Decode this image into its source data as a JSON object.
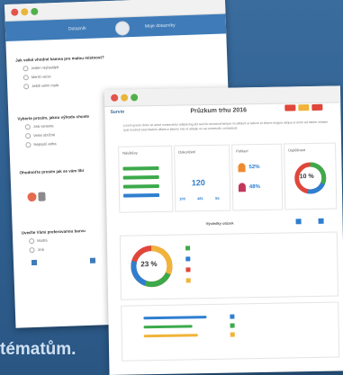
{
  "background_text": "tématům.",
  "back_window": {
    "nav": {
      "tab1": "Dotazník",
      "tab2": "Moje dotazníky"
    },
    "questions": [
      {
        "title": "Jak velké vhodné kamna pro malou místnost?",
        "options": [
          "Jeden nejčastější",
          "Menší verze",
          "Ještě velmi malá"
        ]
      },
      {
        "title": "Vyberte prosím, jakou výhodu chcete",
        "options": [
          "Jiná varianta",
          "Velmi obtížné",
          "Nejlepší volba"
        ]
      },
      {
        "title": "Ohodnoťte prosím jak se vám líbí",
        "options": []
      },
      {
        "title": "Uveďte Vámi preferovanou barvu",
        "options": [
          "Modrá",
          "Jiná"
        ]
      }
    ]
  },
  "front_window": {
    "brand": "Survio",
    "title": "Průzkum trhu 2016",
    "paragraph": "Lorem ipsum dolor sit amet consectetur adipiscing elit sed do eiusmod tempor incididunt ut labore et dolore magna aliqua ut enim ad minim veniam quis nostrud exercitation ullamco laboris nisi ut aliquip ex ea commodo consequat.",
    "stats": {
      "visits_label": "Návštěvy",
      "completed_label": "Dokončení",
      "completed_value": "120",
      "v1": "100",
      "v2": "481",
      "v3": "55",
      "gender_label": "Pohlaví",
      "men_pct": "52%",
      "women_pct": "48%",
      "rate_label": "Úspěšnost",
      "rate_value": "10 %"
    },
    "section_title": "Výsledky otázek",
    "donut2_value": "23 %",
    "colors": {
      "blue": "#2f7fd0",
      "red": "#e0463a",
      "yellow": "#f0b43a",
      "green": "#3caa4b",
      "orange": "#ef8a2f"
    }
  }
}
